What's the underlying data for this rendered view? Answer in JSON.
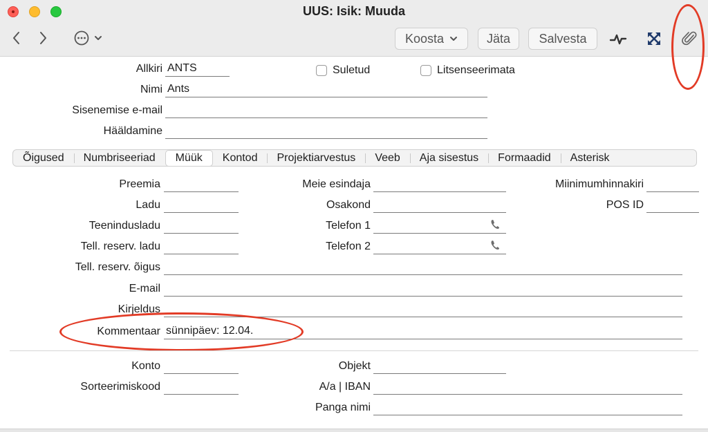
{
  "window": {
    "title": "UUS: Isik: Muuda"
  },
  "toolbar": {
    "koosta_label": "Koosta",
    "jata_label": "Jäta",
    "salvesta_label": "Salvesta"
  },
  "header_form": {
    "allkiri": {
      "label": "Allkiri",
      "value": "ANTS"
    },
    "nimi": {
      "label": "Nimi",
      "value": "Ants"
    },
    "email": {
      "label": "Sisenemise e-mail",
      "value": ""
    },
    "haaldamine": {
      "label": "Hääldamine",
      "value": ""
    },
    "suletud": {
      "label": "Suletud",
      "checked": false
    },
    "litsenseerimata": {
      "label": "Litsenseerimata",
      "checked": false
    }
  },
  "tabs": [
    {
      "label": "Õigused"
    },
    {
      "label": "Numbriseeriad"
    },
    {
      "label": "Müük",
      "active": true
    },
    {
      "label": "Kontod"
    },
    {
      "label": "Projektiarvestus"
    },
    {
      "label": "Veeb"
    },
    {
      "label": "Aja sisestus"
    },
    {
      "label": "Formaadid"
    },
    {
      "label": "Asterisk"
    }
  ],
  "sales": {
    "preemia": {
      "label": "Preemia",
      "value": ""
    },
    "ladu": {
      "label": "Ladu",
      "value": ""
    },
    "teenindusladu": {
      "label": "Teenindusladu",
      "value": ""
    },
    "tell_reserv_ladu": {
      "label": "Tell. reserv. ladu",
      "value": ""
    },
    "meie_esindaja": {
      "label": "Meie esindaja",
      "value": ""
    },
    "osakond": {
      "label": "Osakond",
      "value": ""
    },
    "telefon1": {
      "label": "Telefon 1",
      "value": ""
    },
    "telefon2": {
      "label": "Telefon 2",
      "value": ""
    },
    "miinimumhinnakiri": {
      "label": "Miinimumhinnakiri",
      "value": ""
    },
    "pos_id": {
      "label": "POS ID",
      "value": ""
    },
    "tell_reserv_oigus": {
      "label": "Tell. reserv. õigus",
      "value": ""
    },
    "email": {
      "label": "E-mail",
      "value": ""
    },
    "kirjeldus": {
      "label": "Kirjeldus",
      "value": ""
    },
    "kommentaar": {
      "label": "Kommentaar",
      "value": "sünnipäev: 12.04."
    }
  },
  "bank": {
    "konto": {
      "label": "Konto",
      "value": ""
    },
    "sorteerimiskood": {
      "label": "Sorteerimiskood",
      "value": ""
    },
    "objekt": {
      "label": "Objekt",
      "value": ""
    },
    "aa_iban": {
      "label": "A/a | IBAN",
      "value": ""
    },
    "panga_nimi": {
      "label": "Panga nimi",
      "value": ""
    }
  },
  "icons": {
    "back": "chevron-left-icon",
    "forward": "chevron-right-icon",
    "more": "ellipsis-circle-icon",
    "activity": "activity-icon",
    "expand": "expand-icon",
    "attachment": "paperclip-icon",
    "phone": "phone-icon"
  },
  "colors": {
    "annotation": "#e23b26",
    "window_chrome": "#ececec"
  }
}
